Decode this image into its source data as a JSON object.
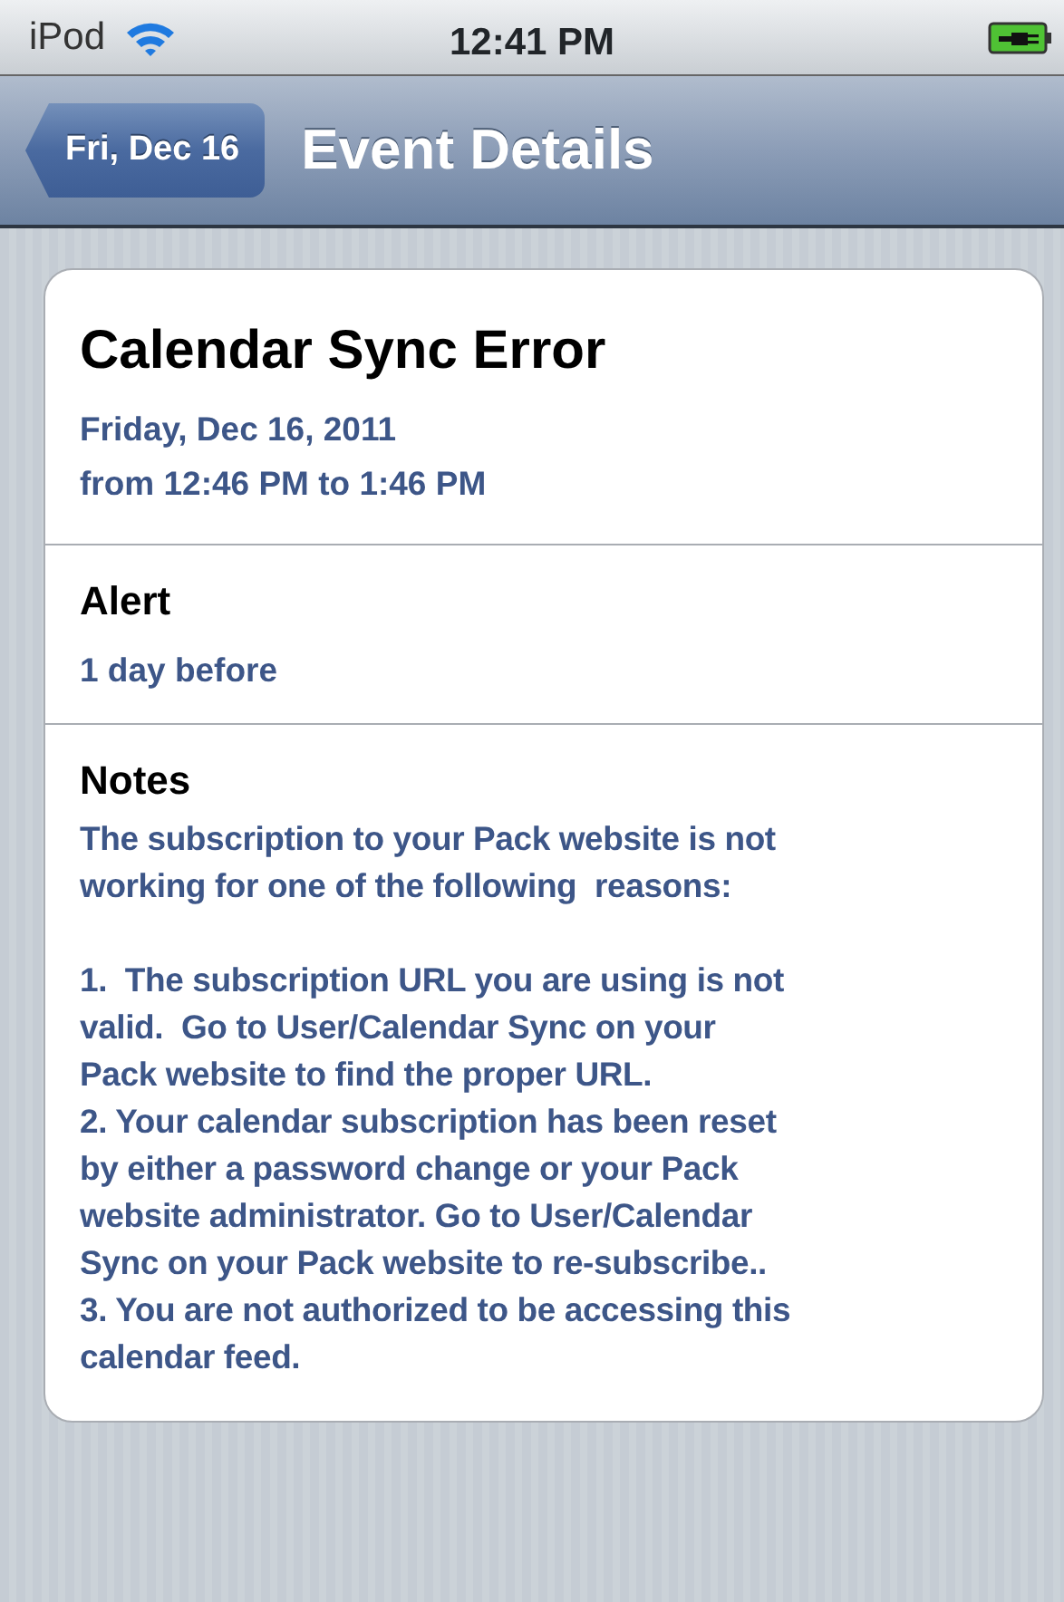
{
  "status_bar": {
    "carrier": "iPod",
    "time": "12:41 PM"
  },
  "nav_bar": {
    "back": "Fri, Dec 16",
    "title": "Event Details"
  },
  "event": {
    "title": "Calendar Sync Error",
    "date": "Friday, Dec 16, 2011",
    "time_range": "from 12:46 PM to 1:46 PM"
  },
  "alert": {
    "label": "Alert",
    "value": "1 day before"
  },
  "notes": {
    "label": "Notes",
    "paragraphs": [
      [
        "The subscription to your Pack website is not",
        "working for one of the following  reasons:"
      ],
      [
        "1.  The subscription URL you are using is not",
        "valid.  Go to User/Calendar Sync on your",
        "Pack website to find the proper URL.",
        "2. Your calendar subscription has been reset",
        "by either a password change or your Pack",
        "website administrator. Go to User/Calendar",
        "Sync on your Pack website to re-subscribe..",
        "3. You are not authorized to be accessing this",
        "calendar feed."
      ]
    ]
  }
}
